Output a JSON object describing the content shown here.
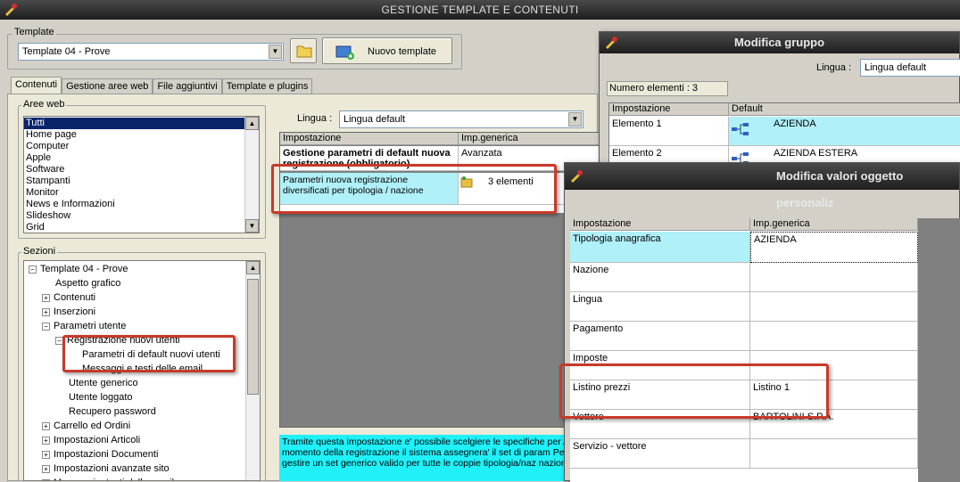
{
  "window": {
    "title": "GESTIONE TEMPLATE E CONTENUTI"
  },
  "template": {
    "group_label": "Template",
    "selected": "Template 04 - Prove",
    "new_button_label": "Nuovo template"
  },
  "tabs": [
    {
      "label": "Contenuti",
      "active": true
    },
    {
      "label": "Gestione aree web",
      "active": false
    },
    {
      "label": "File aggiuntivi",
      "active": false
    },
    {
      "label": "Template e plugins",
      "active": false
    }
  ],
  "aree_web": {
    "label": "Aree web",
    "items": [
      "Tutti",
      "Home page",
      "Computer",
      "Apple",
      "Software",
      "Stampanti",
      "Monitor",
      "News e Informazioni",
      "Slideshow",
      "Grid"
    ],
    "selected_index": 0
  },
  "sezioni": {
    "label": "Sezioni",
    "tree": [
      {
        "label": "Template 04 - Prove",
        "exp": "−"
      },
      {
        "label": "Aspetto grafico",
        "exp": ""
      },
      {
        "label": "Contenuti",
        "exp": "+"
      },
      {
        "label": "Inserzioni",
        "exp": "+"
      },
      {
        "label": "Parametri utente",
        "exp": "−"
      },
      {
        "label": "Registrazione nuovi utenti",
        "exp": "−"
      },
      {
        "label": "Parametri di default nuovi utenti",
        "exp": ""
      },
      {
        "label": "Messaggi e testi delle email",
        "exp": ""
      },
      {
        "label": "Utente generico",
        "exp": ""
      },
      {
        "label": "Utente loggato",
        "exp": ""
      },
      {
        "label": "Recupero password",
        "exp": ""
      },
      {
        "label": "Carrello ed Ordini",
        "exp": "+"
      },
      {
        "label": "Impostazioni Articoli",
        "exp": "+"
      },
      {
        "label": "Impostazioni Documenti",
        "exp": "+"
      },
      {
        "label": "Impostazioni avanzate sito",
        "exp": "+"
      },
      {
        "label": "Messaggi e testi delle email",
        "exp": "+"
      }
    ]
  },
  "main": {
    "lingua_label": "Lingua :",
    "lingua_value": "Lingua default",
    "grid_headers": [
      "Impostazione",
      "Imp.generica"
    ],
    "rows": [
      {
        "name": "Gestione parametri di default nuova registrazione (obbligatorio)",
        "value": "Avanzata"
      },
      {
        "name": "Parametri nuova registrazione diversificati per tipologia / nazione",
        "value": "3 elementi"
      }
    ],
    "info_text": "Tramite questa impostazione e' possibile scelgiere le specifiche per Al momento della registrazione il sistema assegnera' il set di param Per gestire un set generico valido per tutte le coppie tipologia/naz nazione."
  },
  "gruppo_dialog": {
    "title": "Modifica gruppo",
    "lingua_label": "Lingua :",
    "lingua_value": "Lingua default",
    "count_label": "Numero elementi : 3",
    "headers": [
      "Impostazione",
      "Default"
    ],
    "rows": [
      {
        "name": "Elemento 1",
        "value": "AZIENDA"
      },
      {
        "name": "Elemento 2",
        "value": "AZIENDA ESTERA"
      }
    ]
  },
  "valori_dialog": {
    "title": "Modifica valori oggetto personaliz",
    "headers": [
      "Impostazione",
      "Imp.generica"
    ],
    "rows": [
      {
        "name": "Tipologia anagrafica",
        "value": "AZIENDA"
      },
      {
        "name": "Nazione",
        "value": ""
      },
      {
        "name": "Lingua",
        "value": ""
      },
      {
        "name": "Pagamento",
        "value": ""
      },
      {
        "name": "Imposte",
        "value": ""
      },
      {
        "name": "Listino prezzi",
        "value": "Listino 1"
      },
      {
        "name": "Vettore",
        "value": "BARTOLINI S.P.A."
      },
      {
        "name": "Servizio - vettore",
        "value": ""
      }
    ]
  },
  "colors": {
    "highlight_cyan": "#b0f0f8",
    "callout_red": "#c83a2a",
    "selection_blue": "#0a246a"
  }
}
